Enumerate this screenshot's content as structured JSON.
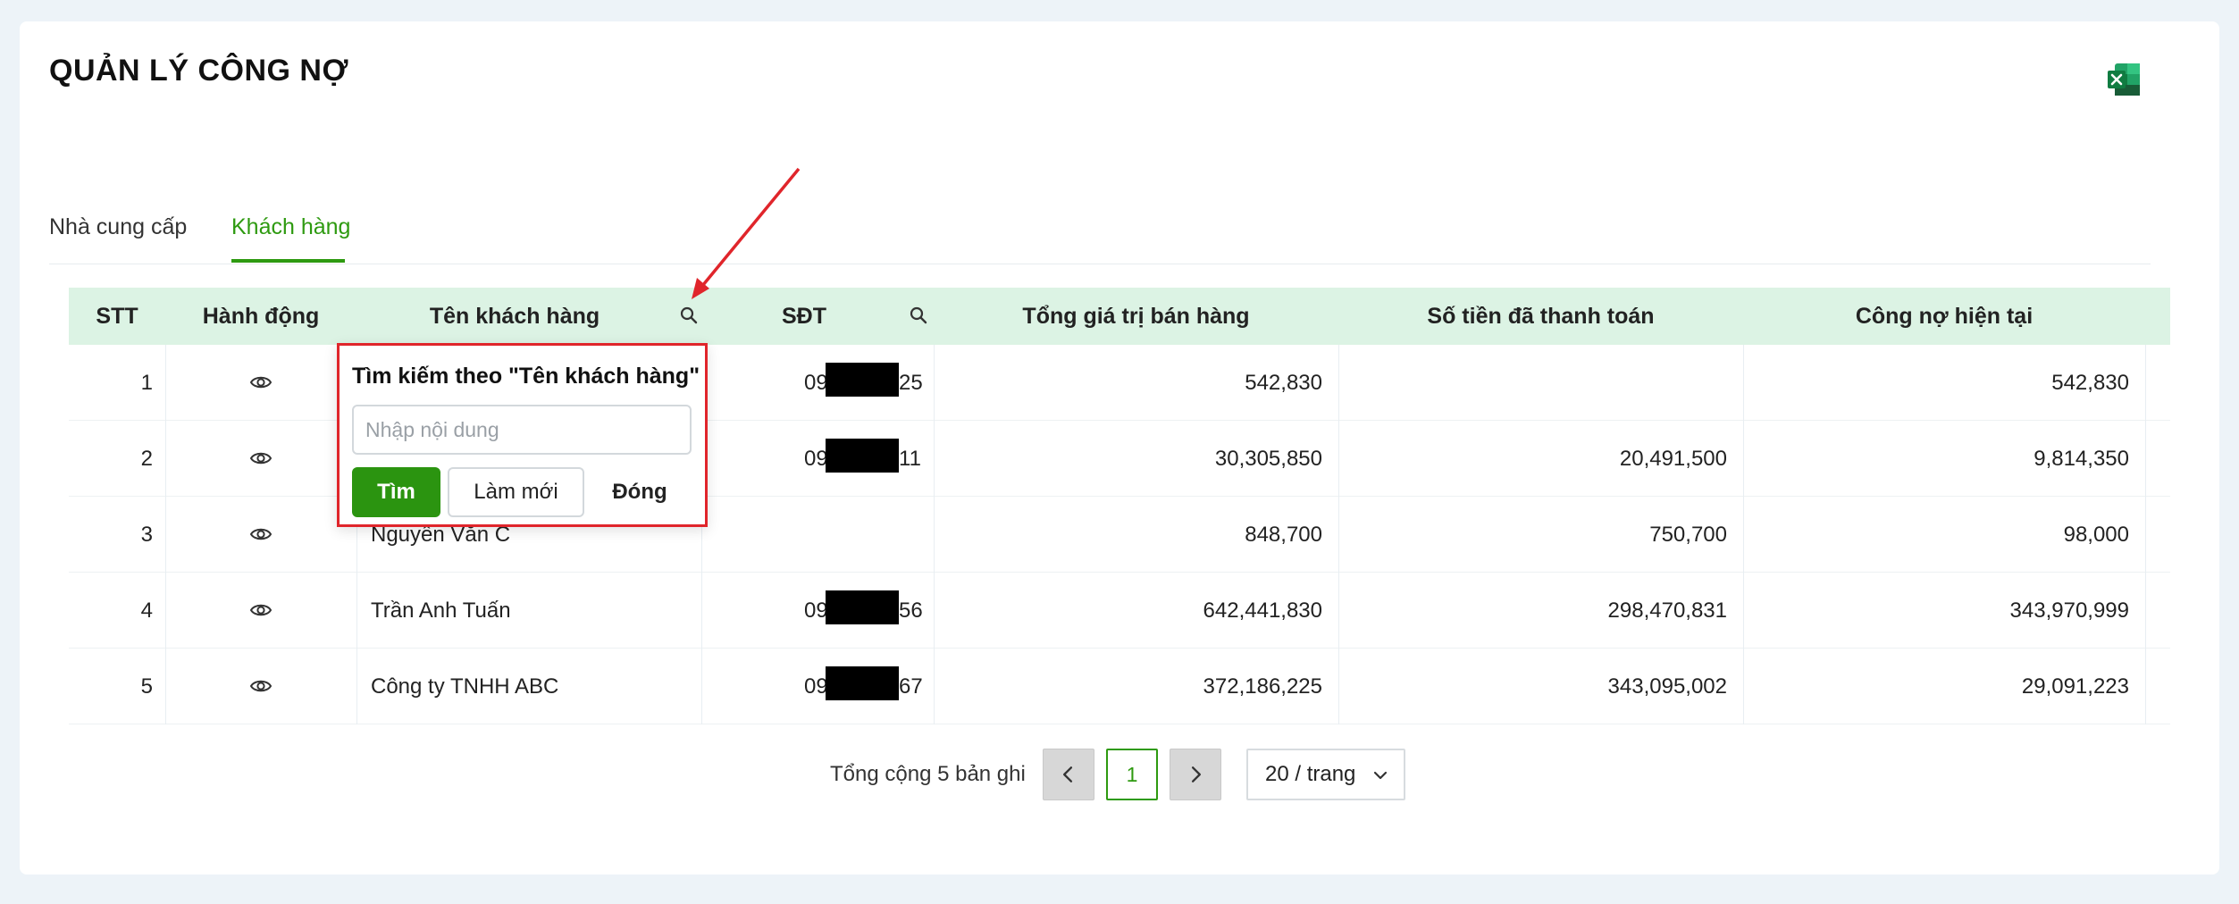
{
  "page": {
    "title": "QUẢN LÝ CÔNG NỢ"
  },
  "toolbar": {
    "export_icon": "excel-icon"
  },
  "tabs": [
    {
      "label": "Nhà cung cấp",
      "active": false
    },
    {
      "label": "Khách hàng",
      "active": true
    }
  ],
  "table": {
    "columns": [
      "STT",
      "Hành động",
      "Tên khách hàng",
      "SĐT",
      "Tổng giá trị bán hàng",
      "Số tiền đã thanh toán",
      "Công nợ hiện tại"
    ],
    "rows": [
      {
        "stt": "1",
        "name": "",
        "phone_prefix": "09",
        "phone_suffix": "25",
        "total": "542,830",
        "paid": "",
        "debt": "542,830"
      },
      {
        "stt": "2",
        "name": "",
        "phone_prefix": "09",
        "phone_suffix": "11",
        "total": "30,305,850",
        "paid": "20,491,500",
        "debt": "9,814,350"
      },
      {
        "stt": "3",
        "name": "Nguyễn Văn C",
        "phone_prefix": "",
        "phone_suffix": "",
        "total": "848,700",
        "paid": "750,700",
        "debt": "98,000"
      },
      {
        "stt": "4",
        "name": "Trần Anh Tuấn",
        "phone_prefix": "09",
        "phone_suffix": "56",
        "total": "642,441,830",
        "paid": "298,470,831",
        "debt": "343,970,999"
      },
      {
        "stt": "5",
        "name": "Công ty TNHH ABC",
        "phone_prefix": "09",
        "phone_suffix": "67",
        "total": "372,186,225",
        "paid": "343,095,002",
        "debt": "29,091,223"
      }
    ]
  },
  "search_popup": {
    "title": "Tìm kiếm theo \"Tên khách hàng\"",
    "placeholder": "Nhập nội dung",
    "value": "",
    "search_label": "Tìm",
    "reset_label": "Làm mới",
    "close_label": "Đóng"
  },
  "pagination": {
    "total_text": "Tổng cộng 5 bản ghi",
    "current_page": "1",
    "page_size_label": "20 / trang"
  },
  "colors": {
    "accent": "#2e9a10",
    "header_bg": "#dcf3e4",
    "highlight": "#e0252b"
  }
}
